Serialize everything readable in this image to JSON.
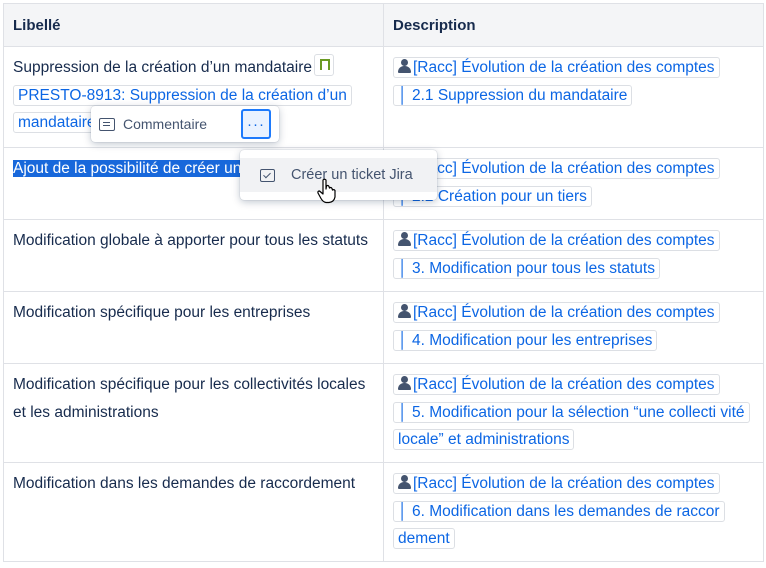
{
  "table": {
    "headers": [
      "Libellé",
      "Description"
    ],
    "rows": [
      {
        "label": "Suppression de la création d’un mandataire",
        "jira_link": "PRESTO-8913: Suppression de la création d’un mandataire",
        "desc_line1": "[Racc] Évolution de la création des comptes",
        "desc_line2": "│ 2.1 Suppression du mandataire"
      },
      {
        "label": "Ajout de la possibilité de créer un tiers",
        "desc_line1": "[Racc] Évolution de la création des comptes",
        "desc_line2": "│ 2.2 Création pour un tiers"
      },
      {
        "label": "Modification globale à apporter pour tous les statuts",
        "desc_line1": "[Racc] Évolution de la création des comptes",
        "desc_line2": "│ 3. Modification pour tous les statuts"
      },
      {
        "label": "Modification spécifique pour les entreprises",
        "desc_line1": "[Racc] Évolution de la création des comptes",
        "desc_line2": "│ 4. Modification pour les entreprises"
      },
      {
        "label": "Modification spécifique pour les collectivités locales et les administrations",
        "desc_line1": "[Racc] Évolution de la création des comptes",
        "desc_line2": "│ 5. Modification pour la sélection “une collecti vité locale” et administrations"
      },
      {
        "label": "Modification dans les demandes de raccordement",
        "desc_line1": "[Racc] Évolution de la création des comptes",
        "desc_line2": "│ 6. Modification dans les demandes de raccor dement"
      }
    ]
  },
  "popup": {
    "comment_label": "Commentaire",
    "more_label": "···"
  },
  "menu": {
    "create_jira_label": "Créer un ticket Jira"
  }
}
